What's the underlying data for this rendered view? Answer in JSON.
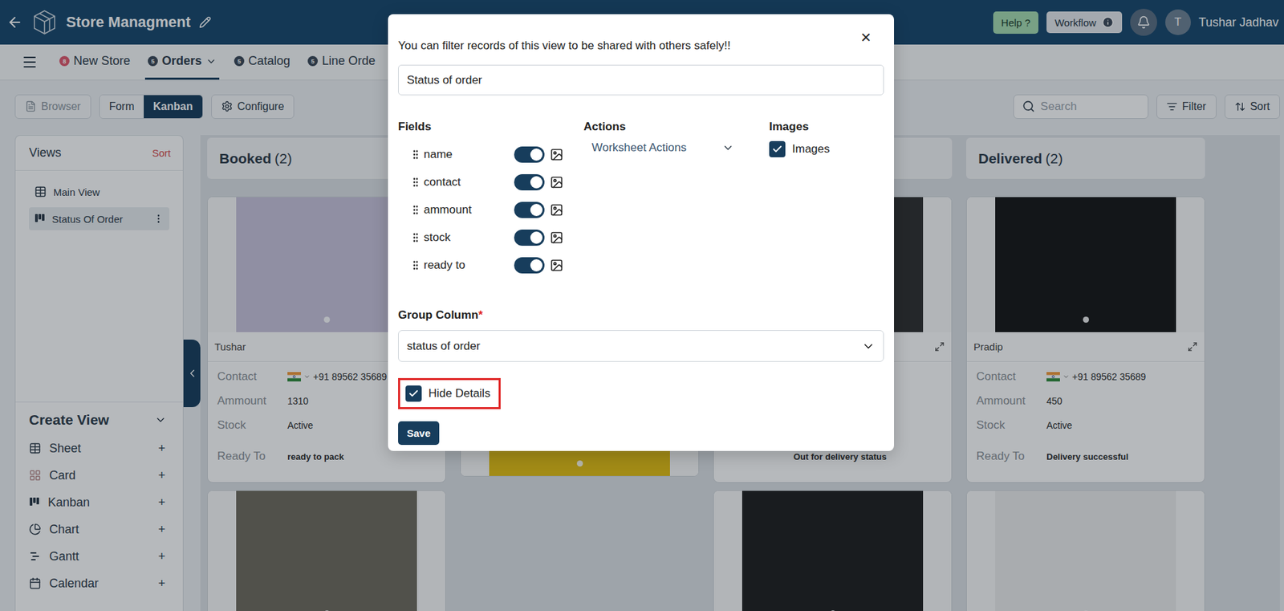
{
  "app": {
    "title": "Store Managment",
    "help": "Help ?",
    "workflow": "Workflow",
    "user": {
      "initial": "T",
      "name": "Tushar Jadhav"
    }
  },
  "tabs": [
    {
      "label": "New Store",
      "count": "8",
      "selected": false,
      "dropdown": false,
      "color": "#e0566b"
    },
    {
      "label": "Orders",
      "count": "5",
      "selected": true,
      "dropdown": true,
      "color": "#3a4756"
    },
    {
      "label": "Catalog",
      "count": "5",
      "selected": false,
      "dropdown": false,
      "color": "#3a4756"
    },
    {
      "label": "Line Orde",
      "count": "5",
      "selected": false,
      "dropdown": false,
      "color": "#3a4756"
    }
  ],
  "toolbar": {
    "browser": {
      "label": "Browser",
      "disabled": true
    },
    "modes": [
      {
        "label": "Form",
        "selected": false
      },
      {
        "label": "Kanban",
        "selected": true
      }
    ],
    "configure": "Configure",
    "search_placeholder": "Search",
    "filter": "Filter",
    "sort": "Sort"
  },
  "sidebar": {
    "title": "Views",
    "sort": "Sort",
    "views": [
      {
        "label": "Main View",
        "kind": "sheet",
        "selected": false
      },
      {
        "label": "Status Of Order",
        "kind": "kanban",
        "selected": true
      }
    ],
    "create_title": "Create View",
    "create_items": [
      {
        "label": "Sheet",
        "kind": "sheet",
        "action": "+"
      },
      {
        "label": "Card",
        "kind": "card",
        "action": "+"
      },
      {
        "label": "Kanban",
        "kind": "kanban",
        "action": "+"
      },
      {
        "label": "Chart",
        "kind": "chart",
        "action": "+"
      },
      {
        "label": "Gantt",
        "kind": "gantt",
        "action": "+"
      },
      {
        "label": "Calendar",
        "kind": "calendar",
        "action": "+"
      }
    ]
  },
  "board": {
    "columns": [
      {
        "title": "Booked",
        "count": "(2)",
        "cards": [
          {
            "name": "Tushar",
            "color": "#c9c3db",
            "fields": [
              {
                "label": "Contact",
                "value": "+91 89562 35689",
                "kind": "phone"
              },
              {
                "label": "Ammount",
                "value": "1310",
                "kind": "text"
              },
              {
                "label": "Stock",
                "value": "Active",
                "kind": "text"
              },
              {
                "label": "Ready To",
                "value": "ready to pack",
                "kind": "bold"
              }
            ]
          },
          {
            "name": "",
            "color": "#6f6a5e",
            "fields": []
          }
        ]
      },
      {
        "title": "",
        "count": "",
        "cards": [
          {
            "name": "",
            "color": "#8a8f96",
            "fields": []
          },
          {
            "name": "",
            "color": "#e3bd12",
            "fields": []
          }
        ]
      },
      {
        "title": "",
        "count": "",
        "cards": [
          {
            "name": "",
            "color": "#2f2f2f",
            "fields": [
              {
                "label": "",
                "value": "",
                "kind": "text"
              },
              {
                "label": "",
                "value": "",
                "kind": "text"
              },
              {
                "label": "",
                "value": "",
                "kind": "text"
              },
              {
                "label": "",
                "value": "Out for delivery status",
                "kind": "bold"
              }
            ]
          },
          {
            "name": "",
            "color": "#1f1f1f",
            "fields": []
          }
        ]
      },
      {
        "title": "Delivered",
        "count": "(2)",
        "cards": [
          {
            "name": "Pradip",
            "color": "#161616",
            "fields": [
              {
                "label": "Contact",
                "value": "+91 89562 35689",
                "kind": "phone"
              },
              {
                "label": "Ammount",
                "value": "450",
                "kind": "text"
              },
              {
                "label": "Stock",
                "value": "Active",
                "kind": "text"
              },
              {
                "label": "Ready To",
                "value": "Delivery successful",
                "kind": "bold"
              }
            ]
          },
          {
            "name": "",
            "color": "#ededed",
            "fields": []
          }
        ]
      }
    ]
  },
  "modal": {
    "subtitle": "You can filter records of this view to be shared with others safely!!",
    "close": "×",
    "view_name": "Status of order",
    "fields_title": "Fields",
    "fields": [
      {
        "name": "name",
        "on": true
      },
      {
        "name": "contact",
        "on": true
      },
      {
        "name": "ammount",
        "on": true
      },
      {
        "name": "stock",
        "on": true
      },
      {
        "name": "ready to",
        "on": true
      }
    ],
    "actions_title": "Actions",
    "actions_select": "Worksheet Actions",
    "images_title": "Images",
    "images": {
      "label": "Images",
      "checked": true
    },
    "group_label": "Group Column",
    "required": "*",
    "group_value": "status of order",
    "hide_details": {
      "label": "Hide Details",
      "checked": true,
      "highlighted": true
    },
    "save": "Save"
  }
}
